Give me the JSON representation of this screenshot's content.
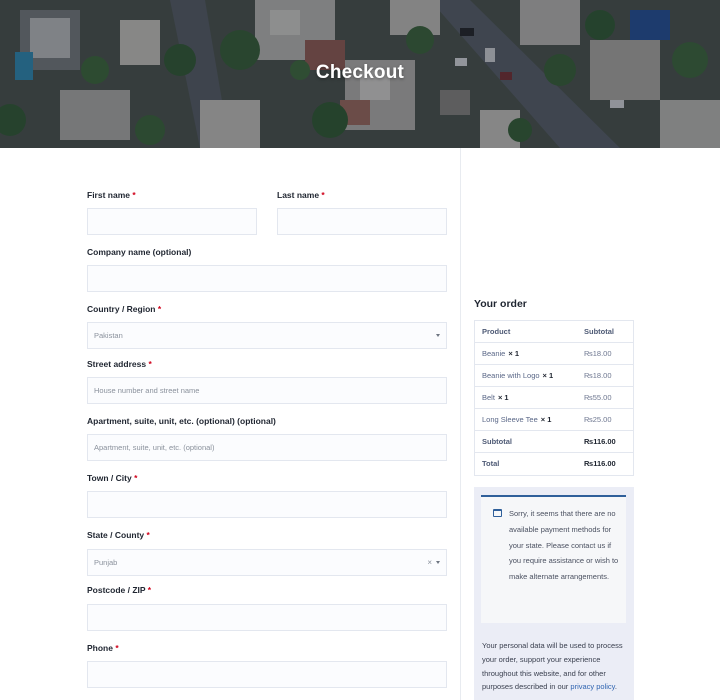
{
  "page": {
    "title": "Checkout"
  },
  "form": {
    "first_name": {
      "label": "First name",
      "required": "*",
      "value": ""
    },
    "last_name": {
      "label": "Last name",
      "required": "*",
      "value": ""
    },
    "company": {
      "label": "Company name (optional)",
      "value": ""
    },
    "country": {
      "label": "Country / Region",
      "required": "*",
      "selected": "Pakistan"
    },
    "street": {
      "label": "Street address",
      "required": "*",
      "placeholder": "House number and street name"
    },
    "apartment": {
      "label": "Apartment, suite, unit, etc. (optional) (optional)",
      "placeholder": "Apartment, suite, unit, etc. (optional)"
    },
    "town": {
      "label": "Town / City",
      "required": "*",
      "value": ""
    },
    "state": {
      "label": "State / County",
      "required": "*",
      "selected": "Punjab",
      "clear": "×"
    },
    "postcode": {
      "label": "Postcode / ZIP",
      "required": "*",
      "value": ""
    },
    "phone": {
      "label": "Phone",
      "required": "*",
      "value": ""
    }
  },
  "order": {
    "heading": "Your order",
    "col_product": "Product",
    "col_subtotal": "Subtotal",
    "items": [
      {
        "name": "Beanie",
        "qty": "× 1",
        "price": "₨18.00"
      },
      {
        "name": "Beanie with Logo",
        "qty": "× 1",
        "price": "₨18.00"
      },
      {
        "name": "Belt",
        "qty": "× 1",
        "price": "₨55.00"
      },
      {
        "name": "Long Sleeve Tee",
        "qty": "× 1",
        "price": "₨25.00"
      }
    ],
    "subtotal_label": "Subtotal",
    "subtotal_value": "₨116.00",
    "total_label": "Total",
    "total_value": "₨116.00"
  },
  "payment": {
    "notice": "Sorry, it seems that there are no available payment methods for your state. Please contact us if you require assistance or wish to make alternate arrangements.",
    "privacy_text": "Your personal data will be used to process your order, support your experience throughout this website, and for other purposes described in our",
    "privacy_link": "privacy policy",
    "privacy_end": "."
  },
  "colors": {
    "accent": "#2f5f9a",
    "required": "#d0021b",
    "link": "#2f64b0"
  }
}
